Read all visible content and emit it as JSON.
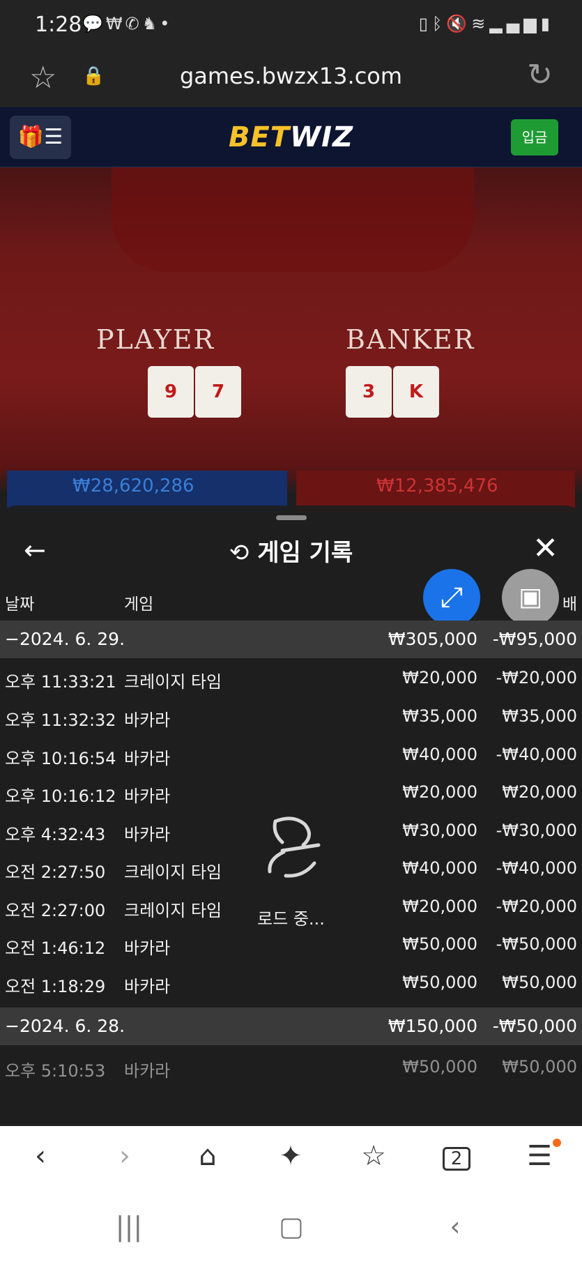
{
  "status_bar": {
    "time": "1:28",
    "left_icons": [
      "chat-icon",
      "won-icon",
      "voicemail-icon",
      "app-icon",
      "dot-icon"
    ],
    "right_icons": [
      "battery-saver-icon",
      "bluetooth-icon",
      "mute-icon",
      "wifi-icon",
      "signal-icon",
      "battery-icon"
    ]
  },
  "url_bar": {
    "url": "games.bwzx13.com"
  },
  "site_header": {
    "logo_part1": "BET",
    "logo_part2": "WIZ",
    "deposit_label": "입금"
  },
  "game_table": {
    "player_label": "PLAYER",
    "banker_label": "BANKER",
    "player_cards": [
      "9",
      "7"
    ],
    "banker_cards": [
      "3",
      "K"
    ],
    "player_bet_total": "₩28,620,286",
    "banker_bet_total": "₩12,385,476"
  },
  "history_sheet": {
    "title": "게임 기록",
    "columns": {
      "date": "날짜",
      "game": "게임",
      "payout_partial": "배"
    },
    "groups": [
      {
        "date": "−2024. 6. 29.",
        "total_bet": "₩305,000",
        "total_result": "-₩95,000",
        "rows": [
          {
            "time": "오후 11:33:21",
            "game": "크레이지 타임",
            "bet": "₩20,000",
            "result": "-₩20,000"
          },
          {
            "time": "오후 11:32:32",
            "game": "바카라",
            "bet": "₩35,000",
            "result": "₩35,000"
          },
          {
            "time": "오후 10:16:54",
            "game": "바카라",
            "bet": "₩40,000",
            "result": "-₩40,000"
          },
          {
            "time": "오후 10:16:12",
            "game": "바카라",
            "bet": "₩20,000",
            "result": "₩20,000"
          },
          {
            "time": "오후 4:32:43",
            "game": "바카라",
            "bet": "₩30,000",
            "result": "-₩30,000"
          },
          {
            "time": "오전 2:27:50",
            "game": "크레이지 타임",
            "bet": "₩40,000",
            "result": "-₩40,000"
          },
          {
            "time": "오전 2:27:00",
            "game": "크레이지 타임",
            "bet": "₩20,000",
            "result": "-₩20,000"
          },
          {
            "time": "오전 1:46:12",
            "game": "바카라",
            "bet": "₩50,000",
            "result": "-₩50,000"
          },
          {
            "time": "오전 1:18:29",
            "game": "바카라",
            "bet": "₩50,000",
            "result": "₩50,000"
          }
        ]
      },
      {
        "date": "−2024. 6. 28.",
        "total_bet": "₩150,000",
        "total_result": "-₩50,000",
        "rows": [
          {
            "time": "오후 5:10:53",
            "game": "바카라",
            "bet": "₩50,000",
            "result": "₩50,000"
          }
        ]
      }
    ],
    "loading_text": "로드 중..."
  },
  "browser_nav": {
    "items": [
      "back-icon",
      "forward-icon",
      "home-icon",
      "ai-sparkle-icon",
      "bookmarks-icon",
      "tabs-icon",
      "menu-icon"
    ],
    "tab_count": "2"
  },
  "system_nav": {
    "items": [
      "recents-icon",
      "home-icon",
      "back-icon"
    ]
  }
}
